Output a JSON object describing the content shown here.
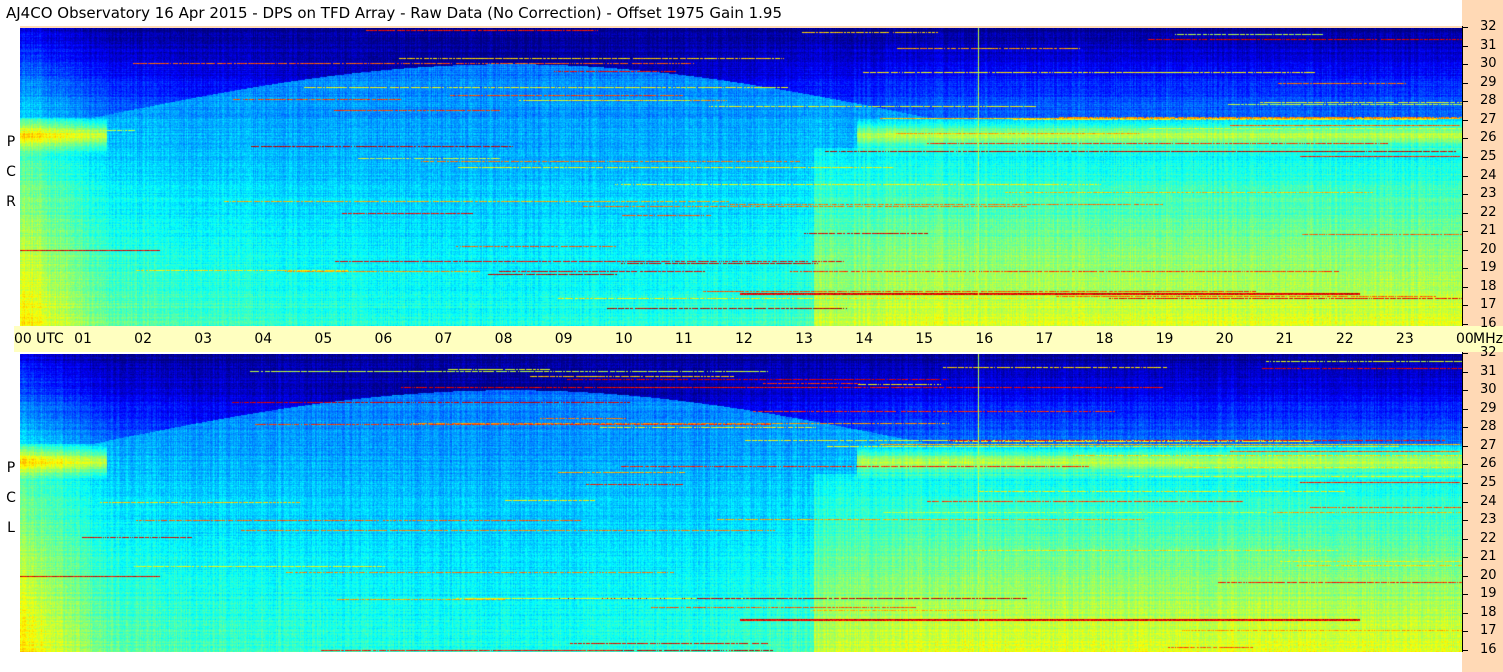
{
  "title": "AJ4CO Observatory  16 Apr 2015  -  DPS on TFD Array  -  Raw Data (No Correction)  -  Offset 1975  Gain 1.95",
  "panels": [
    {
      "id": "rcp",
      "letters": [
        "P",
        "C",
        "R"
      ]
    },
    {
      "id": "lcp",
      "letters": [
        "P",
        "C",
        "L"
      ]
    }
  ],
  "time_axis": {
    "labels": [
      "00",
      "01",
      "02",
      "03",
      "04",
      "05",
      "06",
      "07",
      "08",
      "09",
      "10",
      "11",
      "12",
      "13",
      "14",
      "15",
      "16",
      "17",
      "18",
      "19",
      "20",
      "21",
      "22",
      "23",
      "00"
    ],
    "utc_label": "UTC",
    "mhz_label": "MHz"
  },
  "freq_axis": {
    "labels": [
      "32",
      "31",
      "30",
      "29",
      "28",
      "27",
      "26",
      "25",
      "24",
      "23",
      "22",
      "21",
      "20",
      "19",
      "18",
      "17",
      "16"
    ]
  },
  "colors": {
    "strip": "#ffd9b5",
    "timebar": "#ffffc0"
  }
}
